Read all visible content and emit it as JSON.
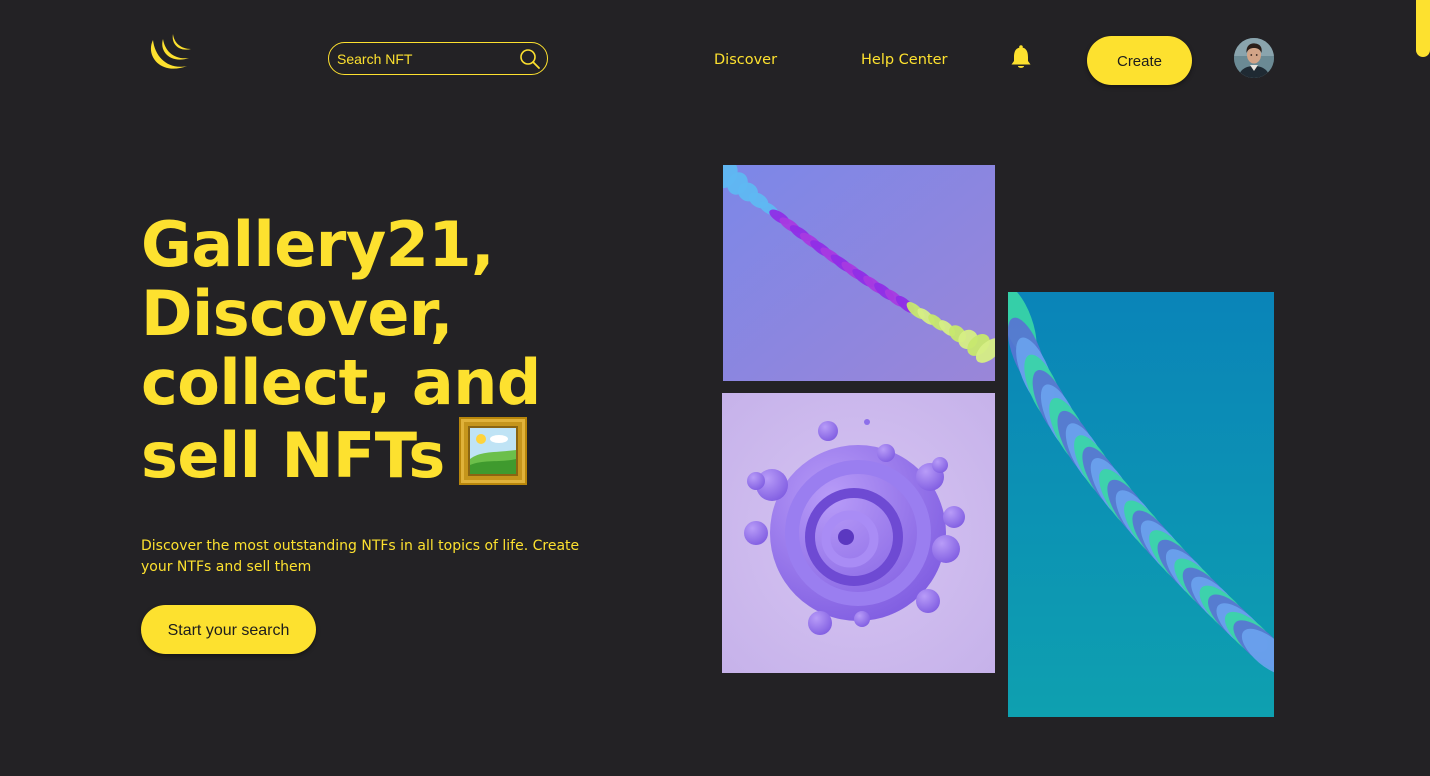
{
  "header": {
    "logo_icon": "crescent-moon-logo",
    "search": {
      "placeholder": "Search NFT",
      "icon": "search-icon"
    },
    "nav": [
      {
        "label": "Discover"
      },
      {
        "label": "Help Center"
      }
    ],
    "notifications_icon": "bell-icon",
    "create_label": "Create",
    "avatar_icon": "user-avatar"
  },
  "hero": {
    "title_lines": [
      "Gallery21,",
      "Discover,",
      "collect, and",
      "sell NFTs"
    ],
    "title_emoji_icon": "framed-picture-icon",
    "subtitle": "Discover the most outstanding NTFs in all topics of life. Create your NTFs and sell them",
    "cta_label": "Start your search"
  },
  "gallery": [
    {
      "name": "purple-spiral-ribbon-artwork"
    },
    {
      "name": "lavender-swirl-bubbles-artwork"
    },
    {
      "name": "teal-green-wave-artwork"
    }
  ],
  "colors": {
    "background": "#232225",
    "accent": "#fde12f",
    "button_text": "#1d1d1d"
  }
}
